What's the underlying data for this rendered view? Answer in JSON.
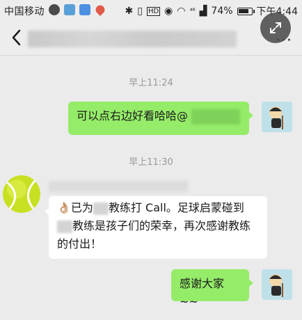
{
  "status_bar": {
    "carrier": "中国移动",
    "network": "⁴⁶",
    "battery_percent": "74%",
    "time": "下午4:44"
  },
  "nav": {
    "more_label": "···"
  },
  "messages": [
    {
      "time": "早上11:24"
    },
    {
      "text": "可以点右边好看哈哈@"
    },
    {
      "time": "早上11:30"
    },
    {
      "line1_a": "已为",
      "line1_b": "教练打 Call。足球启蒙碰到",
      "line2": "教练是孩子们的荣幸，再次感谢教练",
      "line3": "的付出！",
      "emoji": "👌🏼"
    },
    {
      "text": "感谢大家 ~~"
    }
  ],
  "colors": {
    "outgoing_bubble": "#95ec69",
    "incoming_bubble": "#ffffff",
    "background": "#ebebeb"
  }
}
